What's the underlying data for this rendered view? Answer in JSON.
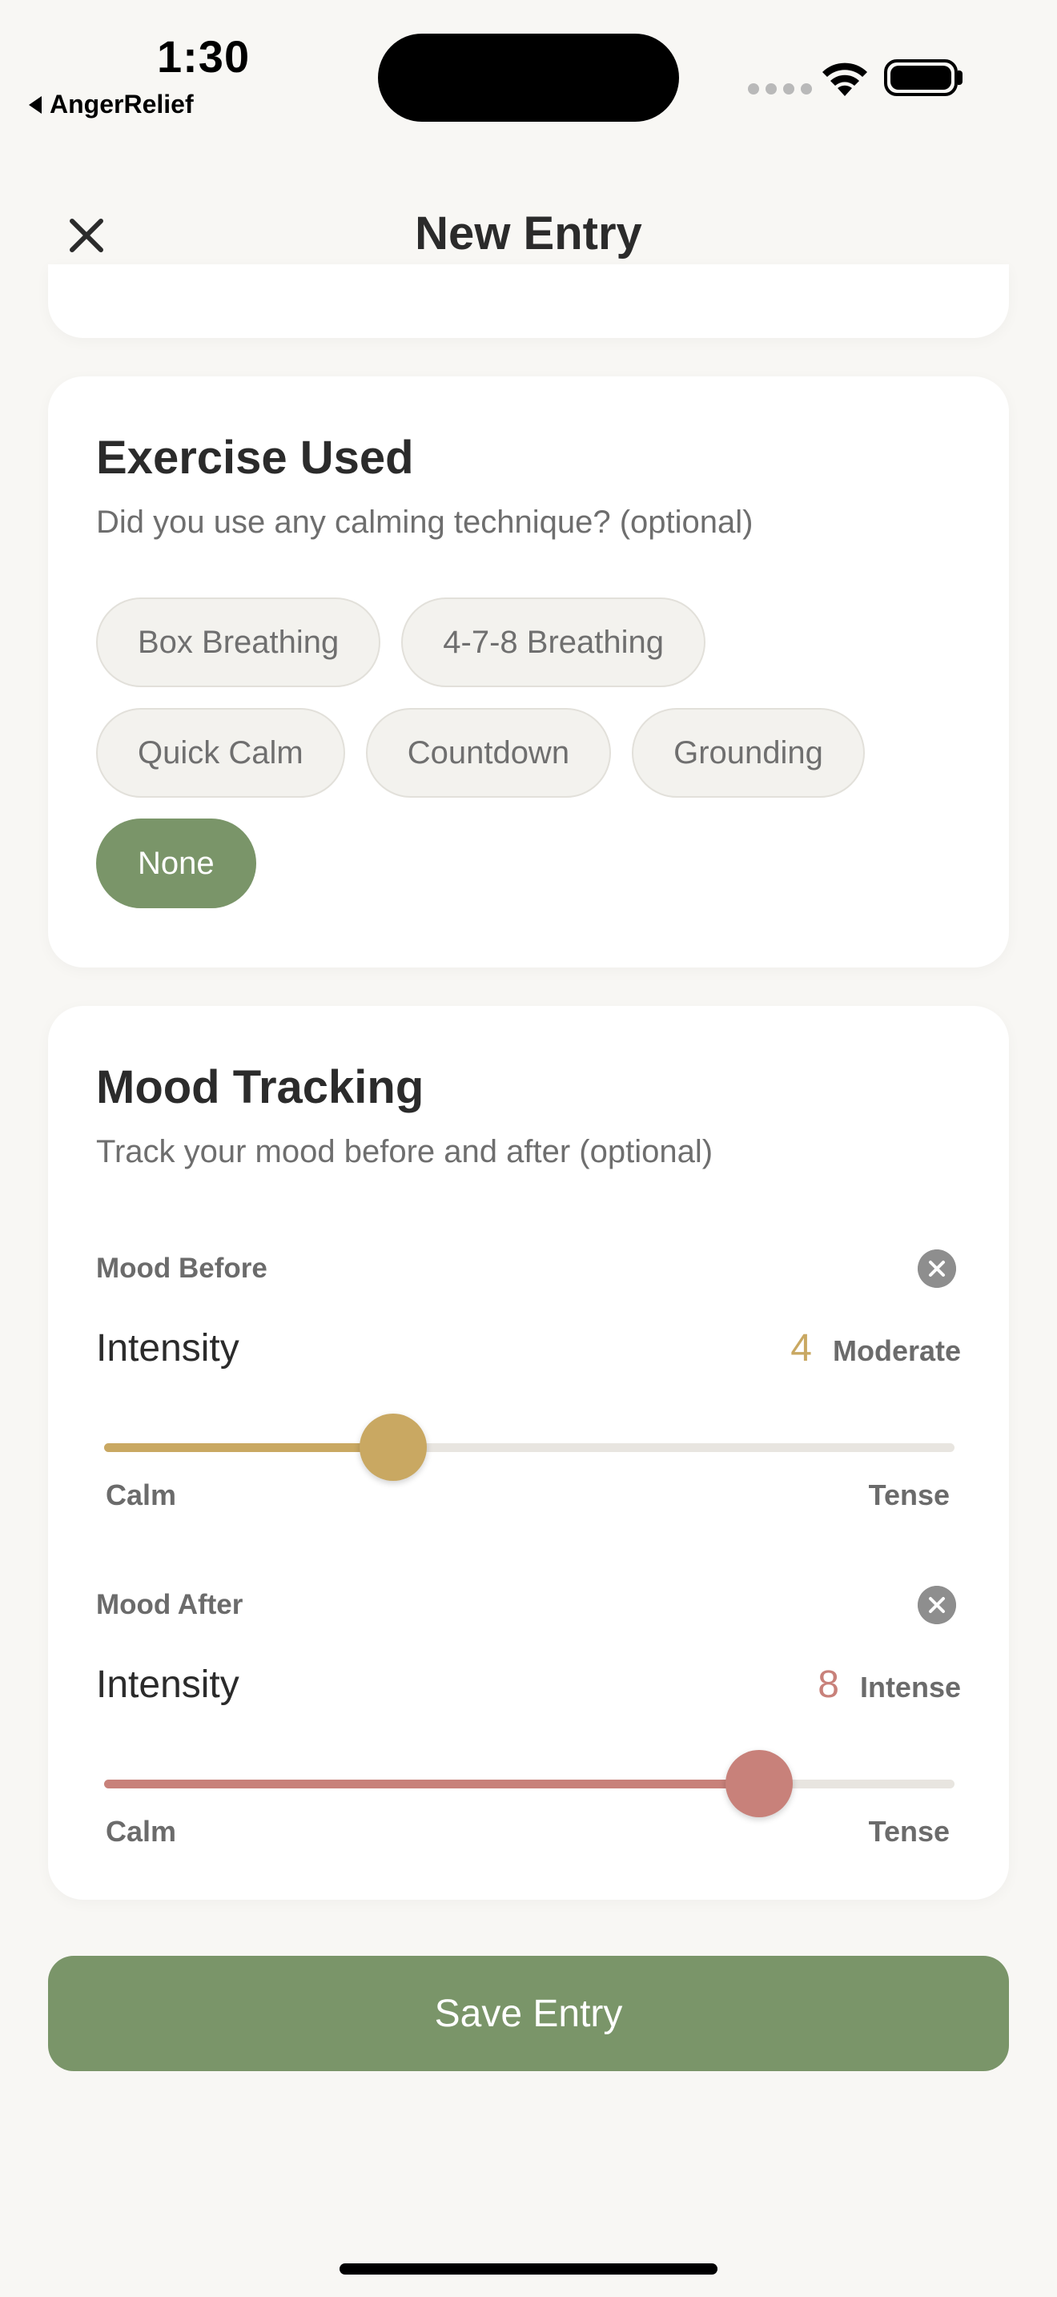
{
  "status": {
    "time": "1:30",
    "back_app": "AngerRelief"
  },
  "nav": {
    "title": "New Entry",
    "close_icon": "close-icon"
  },
  "exercise": {
    "title": "Exercise Used",
    "subtitle": "Did you use any calming technique? (optional)",
    "options": [
      "Box Breathing",
      "4-7-8 Breathing",
      "Quick Calm",
      "Countdown",
      "Grounding",
      "None"
    ],
    "selected": "None"
  },
  "mood": {
    "title": "Mood Tracking",
    "subtitle": "Track your mood before and after (optional)",
    "before": {
      "label": "Mood Before",
      "intensity_label": "Intensity",
      "value": "4",
      "value_word": "Moderate",
      "accent": "#c9a862",
      "min_label": "Calm",
      "max_label": "Tense",
      "level": 0.34
    },
    "after": {
      "label": "Mood After",
      "intensity_label": "Intensity",
      "value": "8",
      "value_word": "Intense",
      "accent": "#c8817a",
      "min_label": "Calm",
      "max_label": "Tense",
      "level": 0.77
    }
  },
  "save_label": "Save Entry",
  "colors": {
    "primary": "#7a9569",
    "background": "#f8f7f4"
  }
}
